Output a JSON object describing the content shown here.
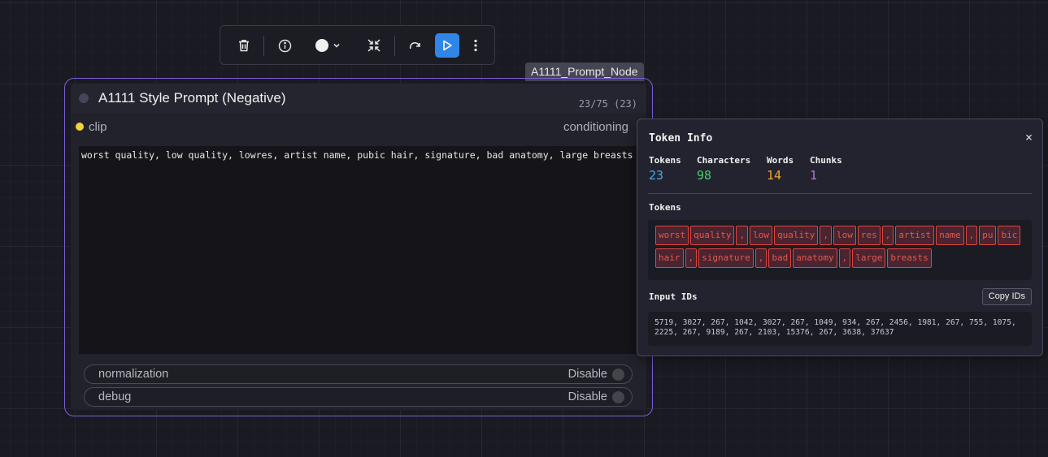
{
  "toolbar": {
    "buttons": [
      "trash-icon",
      "info-icon",
      "color-icon",
      "collapse-icon",
      "redo-icon",
      "run-icon",
      "more-icon"
    ]
  },
  "node_badge": "A1111_Prompt_Node",
  "node": {
    "title": "A1111 Style Prompt (Negative)",
    "token_count": "23/75 (23)",
    "input_label": "clip",
    "output_label": "conditioning",
    "prompt": "worst quality, low quality, lowres, artist name, pubic hair, signature, bad anatomy, large breasts",
    "widgets": [
      {
        "label": "normalization",
        "value": "Disable"
      },
      {
        "label": "debug",
        "value": "Disable"
      }
    ]
  },
  "token_info": {
    "title": "Token Info",
    "close": "×",
    "stats": [
      {
        "label": "Tokens",
        "value": "23",
        "color": "#4aa8e8"
      },
      {
        "label": "Characters",
        "value": "98",
        "color": "#4ccb6f"
      },
      {
        "label": "Words",
        "value": "14",
        "color": "#f2a52b"
      },
      {
        "label": "Chunks",
        "value": "1",
        "color": "#a97ad9"
      }
    ],
    "tokens_label": "Tokens",
    "tokens": [
      "worst",
      "quality",
      ",",
      "low",
      "quality",
      ",",
      "low",
      "res",
      ",",
      "artist",
      "name",
      ",",
      "pu",
      "bic",
      "hair",
      ",",
      "signature",
      ",",
      "bad",
      "anatomy",
      ",",
      "large",
      "breasts"
    ],
    "input_ids_label": "Input IDs",
    "copy_button": "Copy IDs",
    "input_ids": "5719, 3027, 267, 1042, 3027, 267, 1049, 934, 267, 2456, 1981, 267, 755, 1075, 2225, 267, 9189, 267, 2103, 15376, 267, 3638, 37637"
  }
}
